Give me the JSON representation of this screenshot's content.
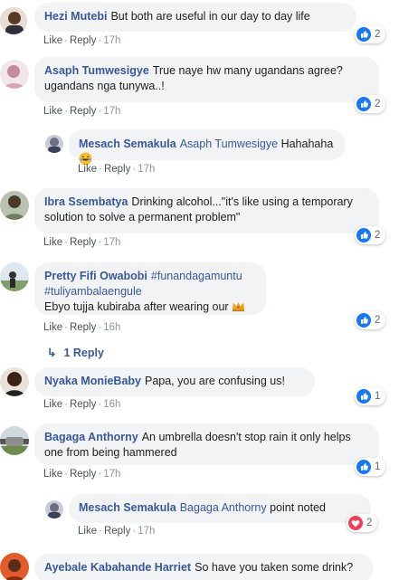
{
  "labels": {
    "like": "Like",
    "reply": "Reply",
    "dot": "·"
  },
  "comments": [
    {
      "name": "Hezi Mutebi",
      "text": "But both are useful in our day to day life",
      "time": "17h",
      "reaction": "like",
      "count": "2"
    },
    {
      "name": "Asaph Tumwesigye",
      "text": "True naye hw many ugandans agree? ugandans nga tunywa..!",
      "time": "17h",
      "reaction": "like",
      "count": "2"
    },
    {
      "name": "Mesach Semakula",
      "mention": "Asaph Tumwesigye",
      "text": "Hahahaha",
      "time": "17h",
      "emoji": "laughing-emoji"
    },
    {
      "name": "Ibra Ssembatya",
      "text": "Drinking alcohol...\"it's like using a temporary solution to solve a permanent problem\"",
      "time": "17h",
      "reaction": "like",
      "count": "2"
    },
    {
      "name": "Pretty Fifi Owabobi",
      "hashtags": "#funandagamuntu #tuliyambalaengule",
      "text": "Ebyo tujja kubiraba after wearing our",
      "time": "16h",
      "emoji": "crown-emoji",
      "reaction": "like",
      "count": "2"
    },
    {
      "name": "Nyaka MonieBaby",
      "text": "Papa, you are confusing us!",
      "time": "16h",
      "reaction": "like",
      "count": "1"
    },
    {
      "name": "Bagaga Anthorny",
      "text": "An umbrella doesn't stop rain it only helps one from being hammered",
      "time": "17h",
      "reaction": "like",
      "count": "1"
    },
    {
      "name": "Mesach Semakula",
      "mention": "Bagaga Anthorny",
      "text": "point noted",
      "time": "17h",
      "reaction": "love",
      "count": "2"
    },
    {
      "name": "Ayebale Kabahande Harriet",
      "text": "So have you taken some drink?"
    }
  ],
  "replies_link": "1 Reply",
  "colors": {
    "link": "#385898",
    "bubble": "#f2f3f5",
    "like_blue": "#1877f2",
    "love_red": "#f33e58"
  }
}
